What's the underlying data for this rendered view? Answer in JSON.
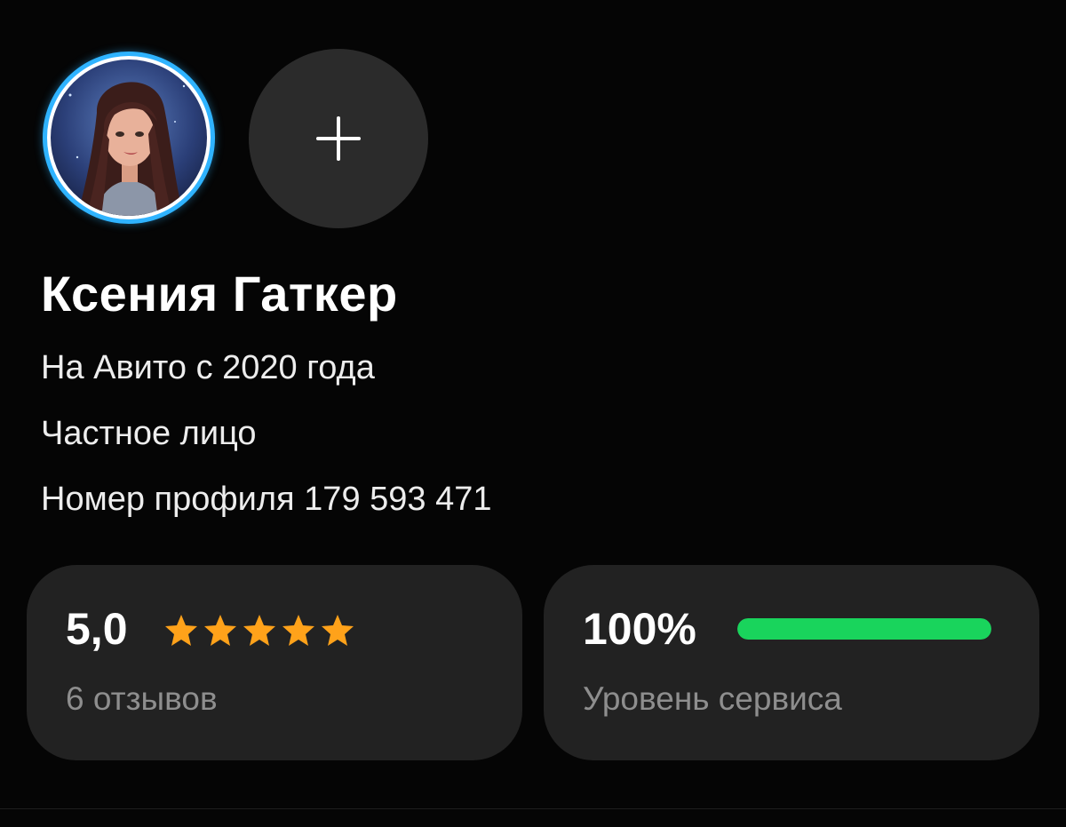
{
  "profile": {
    "name": "Ксения Гаткер",
    "since": "На Авито с 2020 года",
    "type": "Частное лицо",
    "profile_number": "Номер профиля 179 593 471"
  },
  "rating": {
    "value": "5,0",
    "stars_filled": 5,
    "stars_total": 5,
    "reviews_label": "6 отзывов"
  },
  "service": {
    "value": "100%",
    "level_fraction": 1.0,
    "label": "Уровень сервиса"
  },
  "icons": {
    "avatar": "user-avatar-illustration",
    "add": "plus-icon",
    "star": "star-icon"
  },
  "colors": {
    "background": "#050505",
    "card": "#222222",
    "star": "#ffa21a",
    "progress": "#19d45c",
    "avatar_ring": "#2fb3ff"
  }
}
